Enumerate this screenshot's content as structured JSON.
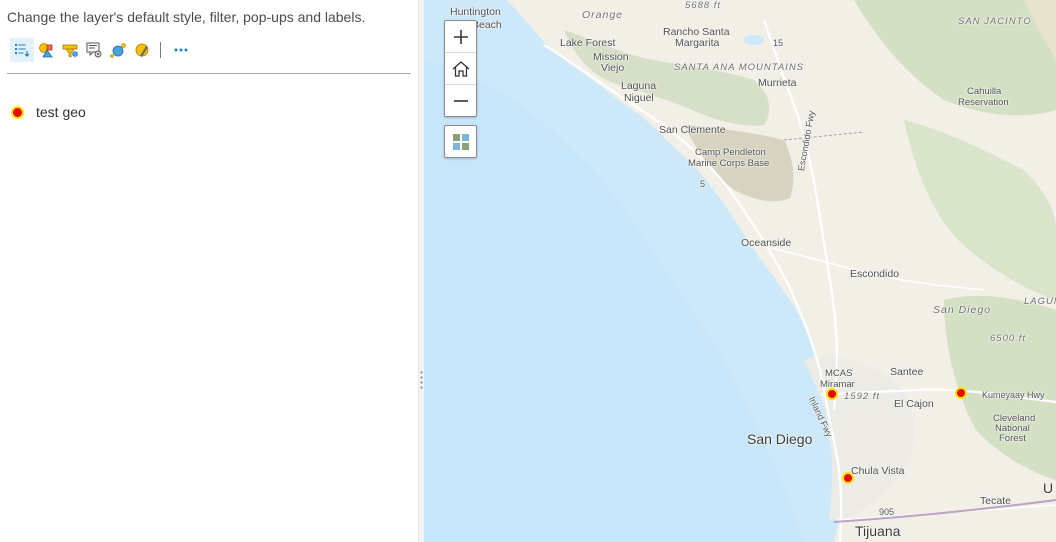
{
  "panel": {
    "description": "Change the layer's default style, filter, pop-ups and labels.",
    "toolbar": {
      "items": [
        {
          "name": "layer-properties-icon",
          "active": true
        },
        {
          "name": "change-style-icon"
        },
        {
          "name": "filter-icon"
        },
        {
          "name": "configure-popup-icon"
        },
        {
          "name": "cluster-points-icon"
        },
        {
          "name": "create-labels-icon"
        },
        {
          "name": "more-options-icon"
        }
      ]
    },
    "layer": {
      "label": "test geo",
      "symbol_fill": "#ee0000",
      "symbol_outline": "#f2e600"
    }
  },
  "map": {
    "labels": {
      "huntington": "Huntington",
      "beach": "Beach",
      "orange": "Orange",
      "elev5688": "5688 ft",
      "san_jacinto": "SAN JACINTO",
      "lake_forest": "Lake Forest",
      "rancho_santa": "Rancho Santa",
      "margarita": "Margarita",
      "mission": "Mission",
      "viejo": "Viejo",
      "santa_ana_mtns": "SANTA ANA MOUNTAINS",
      "laguna": "Laguna",
      "niguel": "Niguel",
      "murrieta": "Murrieta",
      "cahuilla": "Cahuilla",
      "reservation": "Reservation",
      "san_clemente": "San Clemente",
      "camp_pendleton": "Camp Pendleton",
      "marine_corps_base": "Marine Corps Base",
      "escondido_fwy": "Escondido Fwy",
      "oceanside": "Oceanside",
      "escondido": "Escondido",
      "san_diego_region": "San Diego",
      "laguna_mtns": "LAGUNA",
      "elev6500": "6500 ft",
      "mcas": "MCAS",
      "miramar": "Miramar",
      "santee": "Santee",
      "elev1592": "1592 ft",
      "kumeyaay_hwy": "Kumeyaay Hwy",
      "inland_fwy": "Inland Fwy",
      "el_cajon": "El Cajon",
      "cleveland": "Cleveland",
      "national": "National",
      "forest": "Forest",
      "san_diego_city": "San Diego",
      "chula_vista": "Chula Vista",
      "tecate": "Tecate",
      "tijuana": "Tijuana",
      "hwy15": "15",
      "hwy5": "5",
      "hwy905": "905",
      "u_edge": "U"
    },
    "points": [
      {
        "name": "Miramar point",
        "label": "Miramar"
      },
      {
        "name": "Kumeyaay point",
        "label": "Kumeyaay Hwy"
      },
      {
        "name": "Chula Vista point",
        "label": "Chula Vista"
      }
    ],
    "colors": {
      "ocean": "#cde9f9",
      "ocean_deep": "#bfe3f7",
      "land": "#f1efe6",
      "forest": "#d7e3c6",
      "military": "#dcd8c5",
      "road": "#ffffff",
      "border": "#b9a3c6"
    },
    "controls": {
      "zoom_in": "zoom-in",
      "home": "home",
      "zoom_out": "zoom-out",
      "basemap": "basemap-toggle"
    }
  }
}
